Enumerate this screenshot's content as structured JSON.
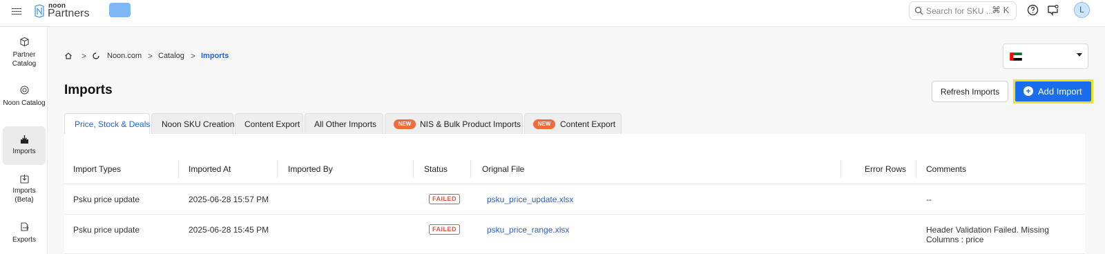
{
  "brand": {
    "small": "noon",
    "name": "Partners"
  },
  "search": {
    "placeholder": "Search for SKU ...",
    "shortcut": "⌘ K"
  },
  "user": {
    "initial": "L"
  },
  "sidebar": {
    "items": [
      {
        "label": "Partner Catalog",
        "icon": "box-icon"
      },
      {
        "label": "Noon Catalog",
        "icon": "catalog-icon"
      },
      {
        "label": "Imports",
        "icon": "import-icon",
        "active": true
      },
      {
        "label": "Imports (Beta)",
        "icon": "import-beta-icon"
      },
      {
        "label": "Exports",
        "icon": "export-icon"
      }
    ]
  },
  "breadcrumb": [
    "Noon.com",
    "Catalog",
    "Imports"
  ],
  "country": {
    "flag": "UAE"
  },
  "page": {
    "title": "Imports",
    "refresh_label": "Refresh Imports",
    "add_label": "Add Import"
  },
  "tabs": [
    {
      "label": "Price, Stock & Deals",
      "active": true
    },
    {
      "label": "Noon SKU Creation"
    },
    {
      "label": "Content Export"
    },
    {
      "label": "All Other Imports"
    },
    {
      "label": "NIS & Bulk Product Imports",
      "badge": "NEW"
    },
    {
      "label": "Content Export",
      "badge": "NEW"
    }
  ],
  "table": {
    "headers": [
      "Import Types",
      "Imported At",
      "Imported By",
      "Status",
      "Orignal File",
      "Error Rows",
      "Comments"
    ],
    "rows": [
      {
        "type": "Psku price update",
        "at": "2025-06-28 15:57 PM",
        "by": "",
        "status": "FAILED",
        "file": "psku_price_update.xlsx",
        "errors": "",
        "comments": "--"
      },
      {
        "type": "Psku price update",
        "at": "2025-06-28 15:45 PM",
        "by": "",
        "status": "FAILED",
        "file": "psku_price_range.xlsx",
        "errors": "",
        "comments": "Header Validation Failed. Missing Columns : price"
      }
    ]
  },
  "colors": {
    "accent": "#1a6dec",
    "highlight": "#f2e21c",
    "failed": "#e0533a",
    "new_badge": "#f26b3a"
  }
}
